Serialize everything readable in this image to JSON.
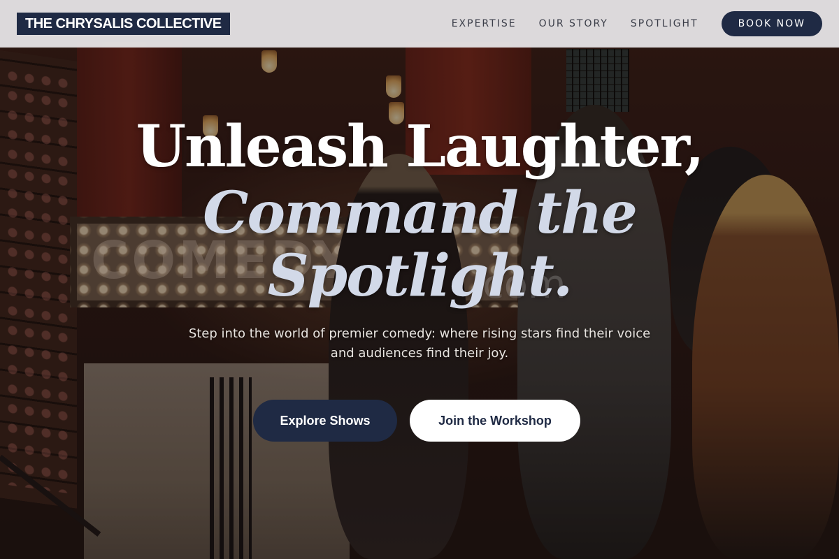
{
  "header": {
    "brand": "THE CHRYSALIS COLLECTIVE",
    "nav": [
      {
        "label": "EXPERTISE"
      },
      {
        "label": "OUR STORY"
      },
      {
        "label": "SPOTLIGHT"
      }
    ],
    "cta": "BOOK NOW"
  },
  "hero": {
    "headline_line1": "Unleash Laughter,",
    "headline_line2": "Command the Spotlight.",
    "subtitle": "Step into the world of premier comedy: where rising stars find their voice and audiences find their joy.",
    "primary_button": "Explore Shows",
    "secondary_button": "Join the Workshop",
    "background_sign_text": "COMEDY",
    "watermark": "com"
  },
  "colors": {
    "brand_navy": "#1f2a44",
    "header_bg": "#e4e2e4",
    "headline_white": "#ffffff",
    "headline_italic": "#d2d9e8"
  }
}
